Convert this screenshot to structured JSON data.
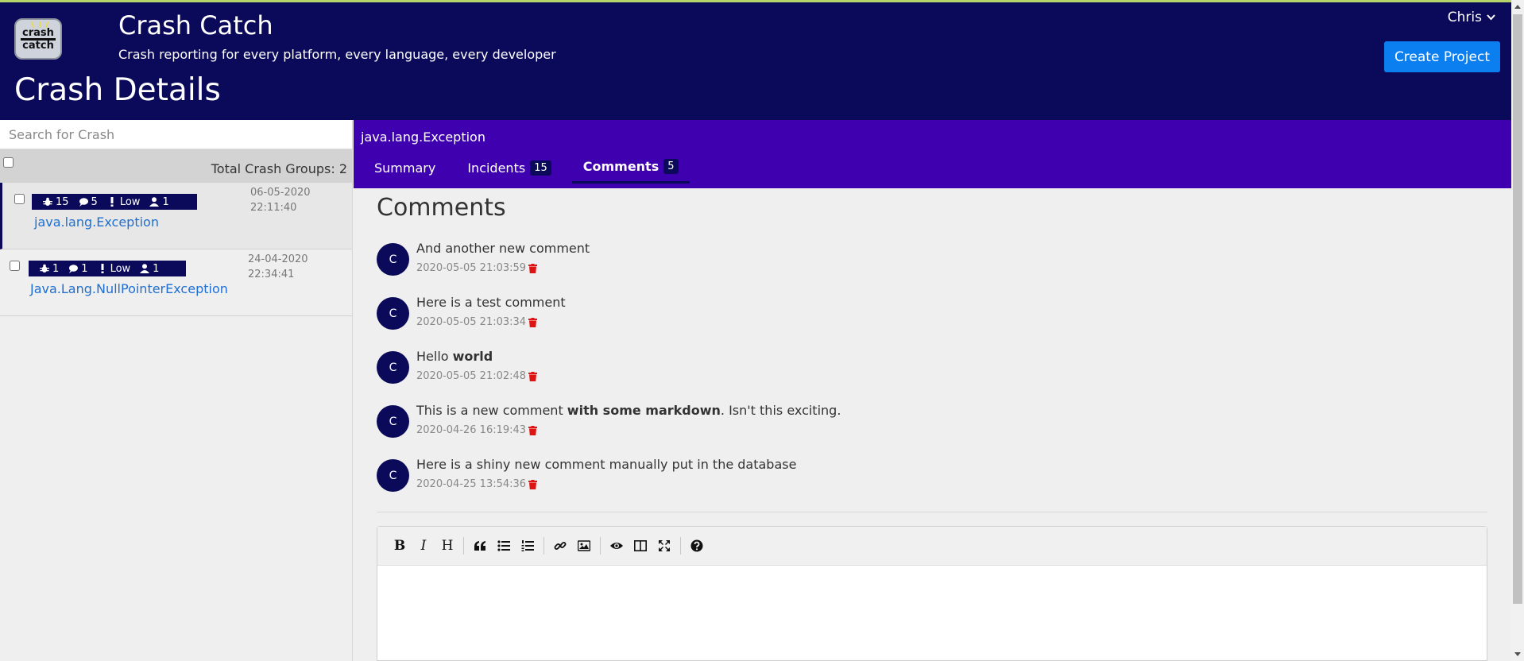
{
  "header": {
    "app_title": "Crash Catch",
    "app_subtitle": "Crash reporting for every platform, every language, every developer",
    "page_title": "Crash Details",
    "user_name": "Chris",
    "create_project_label": "Create Project",
    "logo_text_1": "crash",
    "logo_text_2": "catch"
  },
  "sidebar": {
    "search_placeholder": "Search for Crash",
    "total_label": "Total Crash Groups: 2",
    "items": [
      {
        "incidents": "15",
        "comments": "5",
        "severity": "Low",
        "users": "1",
        "name": "java.lang.Exception",
        "date": "06-05-2020",
        "time": "22:11:40"
      },
      {
        "incidents": "1",
        "comments": "1",
        "severity": "Low",
        "users": "1",
        "name": "Java.Lang.NullPointerException",
        "date": "24-04-2020 22:34:41"
      }
    ]
  },
  "crash": {
    "exception": "java.lang.Exception",
    "tabs": [
      {
        "label": "Summary"
      },
      {
        "label": "Incidents",
        "count": "15"
      },
      {
        "label": "Comments",
        "count": "5"
      }
    ]
  },
  "comments": {
    "title": "Comments",
    "items": [
      {
        "avatar": "C",
        "text": "And another new comment",
        "date": "2020-05-05 21:03:59"
      },
      {
        "avatar": "C",
        "text": "Here is a test comment",
        "date": "2020-05-05 21:03:34"
      },
      {
        "avatar": "C",
        "text_pre": "Hello ",
        "text_bold": "world",
        "text_post": "",
        "date": "2020-05-05 21:02:48"
      },
      {
        "avatar": "C",
        "text_pre": "This is a new comment ",
        "text_bold": "with some markdown",
        "text_post": ". Isn't this exciting.",
        "date": "2020-04-26 16:19:43"
      },
      {
        "avatar": "C",
        "text": "Here is a shiny new comment manually put in the database",
        "date": "2020-04-25 13:54:36"
      }
    ]
  },
  "editor": {
    "bold": "B",
    "italic": "I",
    "heading": "H"
  },
  "colors": {
    "header_bg": "#0b0a5a",
    "crash_header_bg": "#3f00b0",
    "accent_button": "#0b7ff0",
    "link": "#1e6fd1",
    "trash": "#e01313"
  }
}
